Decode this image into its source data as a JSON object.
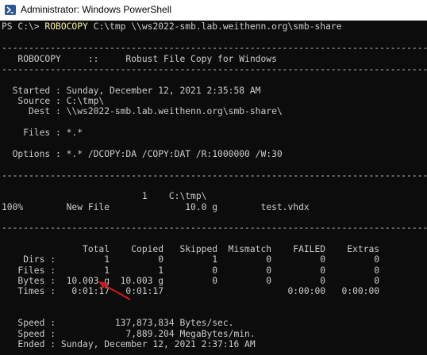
{
  "window": {
    "title": "Administrator: Windows PowerShell",
    "icon": "powershell-icon",
    "background": "#0c0c0c",
    "text_color": "#cccccc",
    "command_color": "#f9f1a5",
    "annotation_color": "#d9161b"
  },
  "console": {
    "prompt": "PS C:\\> ",
    "command": "ROBOCOPY",
    "command_args": " C:\\tmp \\\\ws2022-smb.lab.weithenn.org\\smb-share",
    "lines": [
      "",
      "-------------------------------------------------------------------------------",
      "   ROBOCOPY     ::     Robust File Copy for Windows",
      "-------------------------------------------------------------------------------",
      "",
      "  Started : Sunday, December 12, 2021 2:35:58 AM",
      "   Source : C:\\tmp\\",
      "     Dest : \\\\ws2022-smb.lab.weithenn.org\\smb-share\\",
      "",
      "    Files : *.*",
      "",
      "  Options : *.* /DCOPY:DA /COPY:DAT /R:1000000 /W:30",
      "",
      "-------------------------------------------------------------------------------",
      "",
      "                          1    C:\\tmp\\",
      "100%        New File              10.0 g        test.vhdx",
      "",
      "-------------------------------------------------------------------------------",
      "",
      "               Total    Copied   Skipped  Mismatch    FAILED    Extras",
      "    Dirs :         1         0         1         0         0         0",
      "   Files :         1         1         0         0         0         0",
      "   Bytes :  10.003 g  10.003 g         0         0         0         0",
      "   Times :   0:01:17   0:01:17                       0:00:00   0:00:00",
      "",
      "",
      "   Speed :           137,873,834 Bytes/sec.",
      "   Speed :             7,889.204 MegaBytes/min.",
      "   Ended : Sunday, December 12, 2021 2:37:16 AM"
    ]
  }
}
